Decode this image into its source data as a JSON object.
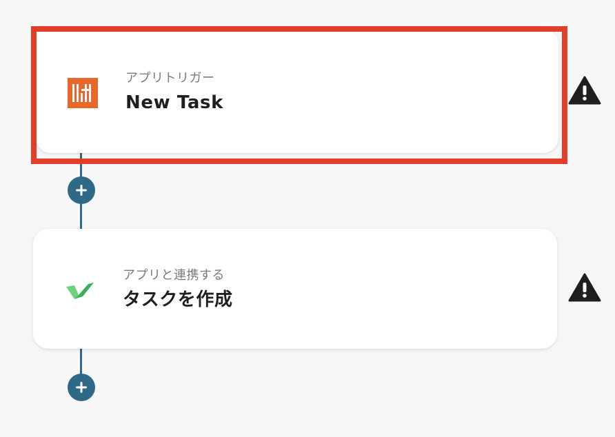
{
  "flow": {
    "steps": [
      {
        "subtitle": "アプリトリガー",
        "title": "New Task",
        "icon": "trigger-app-logo",
        "icon_color": "#e8682a"
      },
      {
        "subtitle": "アプリと連携する",
        "title": "タスクを作成",
        "icon": "task-app-logo",
        "icon_color": "#4caf63"
      }
    ],
    "warning_icon": "warning-icon",
    "add_step_icon": "plus-icon"
  },
  "colors": {
    "highlight": "#e23e2a",
    "connector": "#2e6a86",
    "warning": "#1f1f1f",
    "background": "#f7f7f7"
  }
}
